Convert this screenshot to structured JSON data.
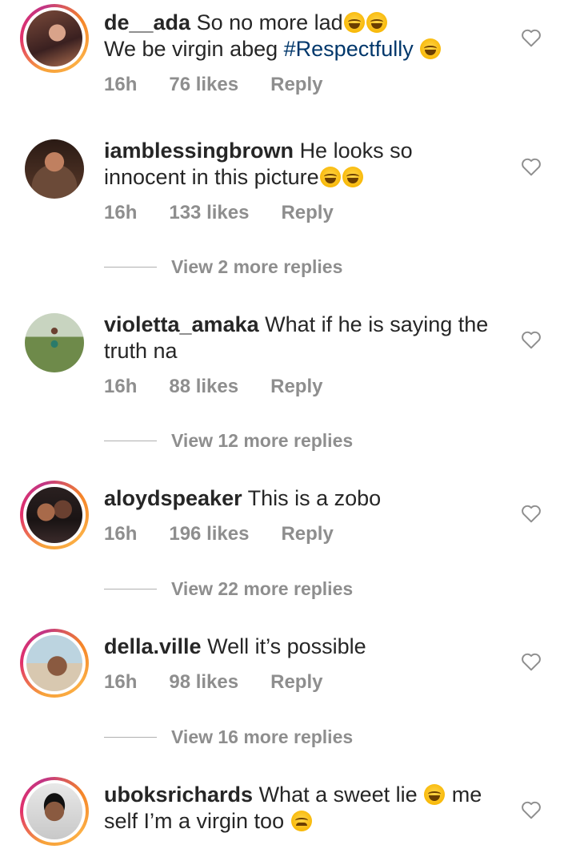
{
  "comments": [
    {
      "username": "de__ada",
      "text": "So no more lad",
      "line2": "We be virgin abeg ",
      "hashtag": "#Respectfully",
      "time": "16h",
      "likes": "76 likes",
      "reply": "Reply",
      "avatar_icon": "profile-photo"
    },
    {
      "username": "iamblessingbrown",
      "text": "He looks so",
      "line2": "innocent in this picture",
      "time": "16h",
      "likes": "133 likes",
      "reply": "Reply",
      "view_replies": "View 2 more replies",
      "avatar_icon": "profile-photo"
    },
    {
      "username": "violetta_amaka",
      "text": "What if he is saying the",
      "line2": "truth na",
      "time": "16h",
      "likes": "88 likes",
      "reply": "Reply",
      "view_replies": "View 12 more replies",
      "avatar_icon": "profile-photo"
    },
    {
      "username": "aloydspeaker",
      "text": "This is a zobo",
      "time": "16h",
      "likes": "196 likes",
      "reply": "Reply",
      "view_replies": "View 22 more replies",
      "avatar_icon": "profile-photo"
    },
    {
      "username": "della.ville",
      "text": "Well it’s possible",
      "time": "16h",
      "likes": "98 likes",
      "reply": "Reply",
      "view_replies": "View 16 more replies",
      "avatar_icon": "profile-photo"
    },
    {
      "username": "uboksrichards",
      "text": "What a sweet lie",
      "text_after_emoji": "me",
      "line2": "self I’m a virgin too",
      "avatar_icon": "profile-photo"
    }
  ],
  "colors": {
    "text": "#262626",
    "meta": "#8e8e8e",
    "hashtag": "#00376b",
    "story_ring": "#e1306c"
  },
  "icons": {
    "like": "heart-outline-icon",
    "laugh": "face-with-tears-of-joy-emoji",
    "sad": "crying-face-emoji"
  }
}
